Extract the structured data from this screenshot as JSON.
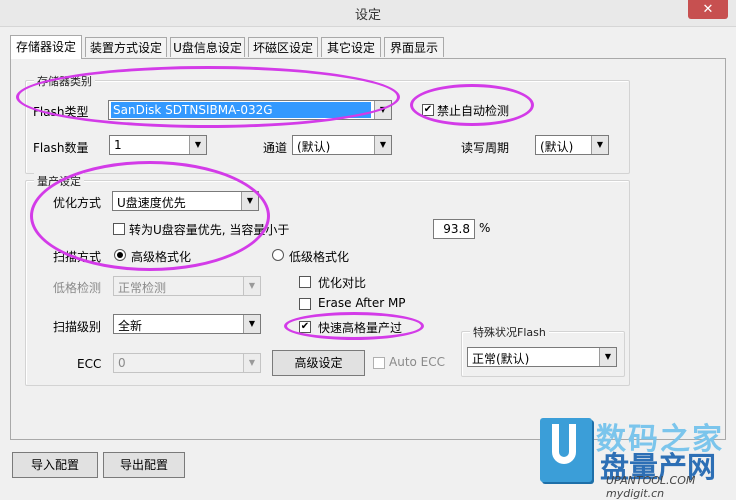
{
  "window": {
    "title": "设定",
    "close_label": "✕"
  },
  "tabs": [
    "存储器设定",
    "装置方式设定",
    "U盘信息设定",
    "坏磁区设定",
    "其它设定",
    "界面显示"
  ],
  "storage_group": {
    "title": "存储器类别",
    "flash_type_label": "Flash类型",
    "flash_type_value": "SanDisk SDTNSIBMA-032G",
    "disable_auto_detect_label": "禁止自动检测",
    "flash_count_label": "Flash数量",
    "flash_count_value": "1",
    "channel_label": "通道",
    "channel_value": "(默认)",
    "rw_cycle_label": "读写周期",
    "rw_cycle_value": "(默认)"
  },
  "production_group": {
    "title": "量产设定",
    "optimize_label": "优化方式",
    "optimize_value": "U盘速度优先",
    "capacity_priority_label": "转为U盘容量优先, 当容量小于",
    "capacity_value": "93.8",
    "percent_label": "%",
    "scan_mode_label": "扫描方式",
    "high_format_label": "高级格式化",
    "low_format_label": "低级格式化",
    "low_format_detect_label": "低格检测",
    "low_format_detect_value": "正常检测",
    "optimize_compare_label": "优化对比",
    "erase_after_mp_label": "Erase After MP",
    "fast_high_format_label": "快速高格量产过",
    "scan_level_label": "扫描级别",
    "scan_level_value": "全新",
    "ecc_label": "ECC",
    "ecc_value": "0",
    "advanced_settings_label": "高级设定",
    "auto_ecc_label": "Auto ECC",
    "special_flash_title": "特殊状况Flash",
    "special_flash_value": "正常(默认)"
  },
  "footer": {
    "import_label": "导入配置",
    "export_label": "导出配置"
  },
  "watermark": {
    "line1": "数码之家",
    "line2": "盘量产网",
    "url": "UPANTOOL.COM",
    "url2": "mydigit.cn"
  },
  "colors": {
    "highlight": "#d33be8",
    "selection": "#3399ff"
  }
}
